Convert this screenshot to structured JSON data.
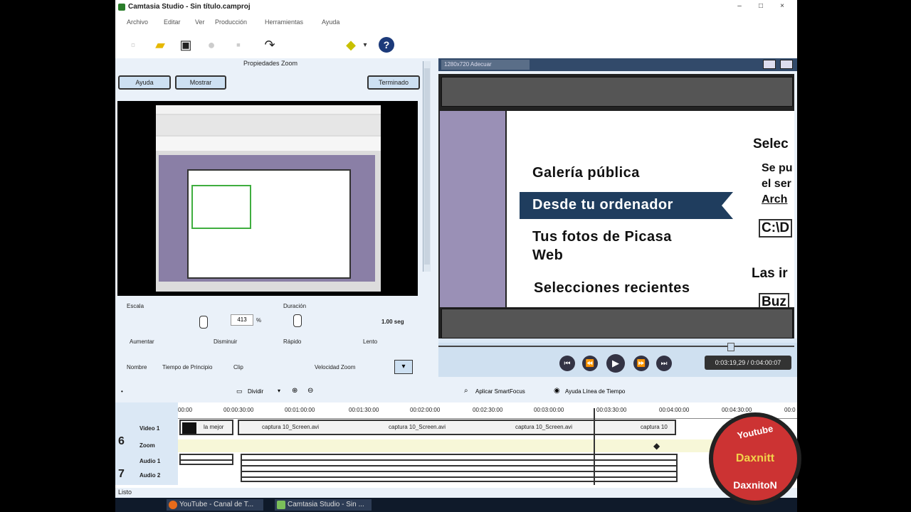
{
  "window": {
    "title": "Camtasia Studio - Sin título.camproj"
  },
  "menu": [
    "Archivo",
    "Editar",
    "Ver",
    "Producción",
    "Herramientas",
    "Ayuda"
  ],
  "zoom_panel": {
    "title": "Propiedades Zoom",
    "help_label": "Ayuda",
    "show_label": "Mostrar",
    "done_label": "Terminado",
    "scale_label": "Escala",
    "duration_label": "Duración",
    "scale_value": "413",
    "scale_unit": "%",
    "duration_value": "1.00 seg",
    "increase_label": "Aumentar",
    "decrease_label": "Disminuir",
    "fast_label": "Rápido",
    "slow_label": "Lento",
    "col_name": "Nombre",
    "col_start": "Tiempo de Principio",
    "col_clip": "Clip",
    "col_speed": "Velocidad Zoom"
  },
  "preview": {
    "size_label": "1280x720 Adecuar",
    "menu_items": [
      "Galería pública",
      "Desde tu ordenador",
      "Tus fotos de Picasa",
      "Web",
      "Selecciones recientes"
    ],
    "right_texts": [
      "Selec",
      "Se pu",
      "el ser",
      "Arch",
      "C:\\D",
      "Las ir",
      "Buz"
    ],
    "time_display": "0:03:19,29 / 0:04:00:07"
  },
  "timeline_toolbar": {
    "split_label": "Dividir",
    "smartfocus_label": "Aplicar SmartFocus",
    "help_label": "Ayuda Línea de Tiempo"
  },
  "timeline": {
    "ruler": [
      "00:00",
      "00:00:30:00",
      "00:01:00:00",
      "00:01:30:00",
      "00:02:00:00",
      "00:02:30:00",
      "00:03:00:00",
      "00:03:30:00",
      "00:04:00:00",
      "00:04:30:00",
      "00:0"
    ],
    "track_labels": [
      "Video 1",
      "Zoom",
      "Audio 1",
      "Audio 2"
    ],
    "video_clips": [
      "la mejor",
      "captura 10_Screen.avi",
      "captura 10_Screen.avi",
      "captura 10_Screen.avi",
      "captura 10"
    ]
  },
  "status": {
    "text": "Listo"
  },
  "taskbar": {
    "items": [
      "YouTube - Canal de T...",
      "Camtasia Studio - Sin ..."
    ]
  },
  "watermark": {
    "lines": [
      "Youtube",
      "Daxnitt",
      "DaxnitoN"
    ]
  }
}
